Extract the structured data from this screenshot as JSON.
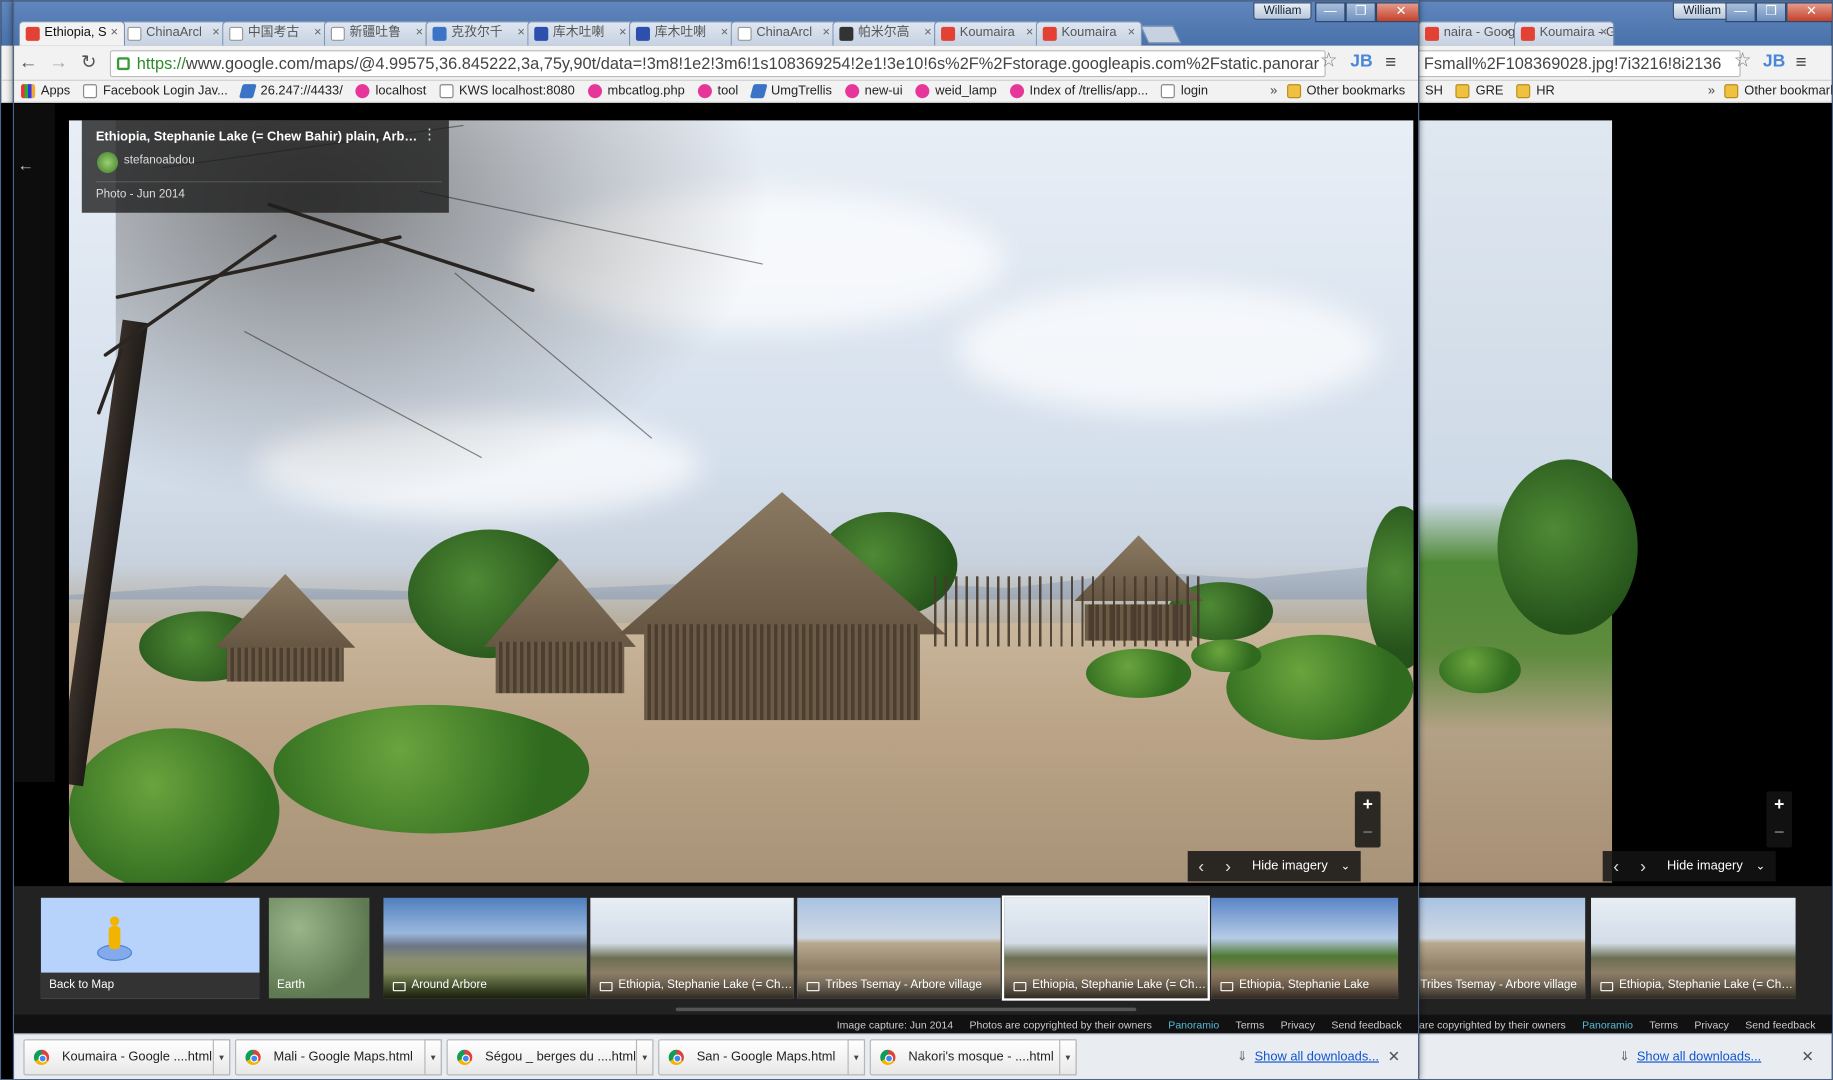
{
  "user_name": "William",
  "window_controls": {
    "minimize": "—",
    "restore": "❐",
    "close": "✕"
  },
  "tabs": [
    {
      "label": "Ethiopia, S",
      "favicon_color": "#e34133",
      "active": true
    },
    {
      "label": "ChinaArcl",
      "favicon_color": "#ffffff"
    },
    {
      "label": "中国考古",
      "favicon_color": "#ffffff"
    },
    {
      "label": "新疆吐鲁",
      "favicon_color": "#ffffff"
    },
    {
      "label": "克孜尔千",
      "favicon_color": "#3b73c7"
    },
    {
      "label": "库木吐喇",
      "favicon_color": "#2d4fae"
    },
    {
      "label": "库木吐喇",
      "favicon_color": "#2d4fae"
    },
    {
      "label": "ChinaArcl",
      "favicon_color": "#ffffff"
    },
    {
      "label": "帕米尔高",
      "favicon_color": "#333333"
    },
    {
      "label": "Koumaira",
      "favicon_color": "#e34133"
    },
    {
      "label": "Koumaira",
      "favicon_color": "#e34133"
    }
  ],
  "bg_tabs": [
    {
      "label": "naira - Googl"
    },
    {
      "label": "Koumaira - Googl"
    }
  ],
  "url": {
    "scheme": "https://",
    "text": "www.google.com/maps/@4.99575,36.845222,3a,75y,90t/data=!3m8!1e2!3m6!1s108369254!2e1!3e10!6s%2F%2Fstorage.googleapis.com%2Fstatic.panorar"
  },
  "bg_url": "Fsmall%2F108369028.jpg!7i3216!8i2136",
  "toolbar_icons": {
    "back": "←",
    "forward": "→",
    "reload": "↻",
    "star": "☆",
    "jb": "JB",
    "menu": "≡"
  },
  "bookmarks": [
    {
      "label": "Apps",
      "icon": "grid"
    },
    {
      "label": "Facebook Login Jav...",
      "icon": "page"
    },
    {
      "label": "26.247://4433/",
      "icon": "jira"
    },
    {
      "label": "localhost",
      "icon": "pink"
    },
    {
      "label": "KWS localhost:8080",
      "icon": "page"
    },
    {
      "label": "mbcatlog.php",
      "icon": "pink"
    },
    {
      "label": "tool",
      "icon": "pink"
    },
    {
      "label": "UmgTrellis",
      "icon": "jira"
    },
    {
      "label": "new-ui",
      "icon": "pink"
    },
    {
      "label": "weid_lamp",
      "icon": "pink"
    },
    {
      "label": "Index of /trellis/app...",
      "icon": "pink"
    },
    {
      "label": "login",
      "icon": "page"
    }
  ],
  "bookmarks_overflow": "»",
  "other_bookmarks": "Other bookmarks",
  "bg_bookmarks": [
    "SH",
    "GRE",
    "HR"
  ],
  "photo_info": {
    "title": "Ethiopia, Stephanie Lake (= Chew Bahir) plain, Arbore vill...",
    "author": "stefanoabdou",
    "date": "Photo - Jun 2014",
    "menu": "⋮"
  },
  "back_arrow": "←",
  "zoom": {
    "plus": "+",
    "minus": "−"
  },
  "photo_nav": {
    "prev": "‹",
    "next": "›",
    "hide_label": "Hide imagery",
    "hide_icon": "⌄"
  },
  "thumbnails": [
    {
      "label": "Back to Map",
      "kind": "backmap"
    },
    {
      "label": "Earth",
      "kind": "earth"
    },
    {
      "label": "Around Arbore",
      "kind": "mtn"
    },
    {
      "label": "Ethiopia, Stephanie Lake (= Che...",
      "kind": "huts"
    },
    {
      "label": "Tribes Tsemay - Arbore village",
      "kind": "tsemay"
    },
    {
      "label": "Ethiopia, Stephanie Lake (= Che...",
      "kind": "huts",
      "selected": true
    },
    {
      "label": "Ethiopia, Stephanie Lake",
      "kind": "red"
    }
  ],
  "bg_thumbnails": [
    {
      "label": "Tribes Tsemay - Arbore village",
      "kind": "tsemay"
    },
    {
      "label": "Ethiopia, Stephanie Lake (= Che...",
      "kind": "huts"
    }
  ],
  "footer": {
    "capture": "Image capture: Jun 2014",
    "copyright": "Photos are copyrighted by their owners",
    "bg_copyright": "s are copyrighted by their owners",
    "panoramio": "Panoramio",
    "terms": "Terms",
    "privacy": "Privacy",
    "feedback": "Send feedback"
  },
  "downloads": [
    {
      "label": "Koumaira - Google ....html"
    },
    {
      "label": "Mali - Google Maps.html"
    },
    {
      "label": "Ségou _ berges du ....html"
    },
    {
      "label": "San - Google Maps.html"
    },
    {
      "label": "Nakori's mosque - ....html"
    }
  ],
  "show_all_downloads": "Show all downloads...",
  "download_close": "✕",
  "colors": {
    "accent": "#4a86d8",
    "titlebar": "#5f86bd",
    "panoramio": "#5ab9d8"
  }
}
